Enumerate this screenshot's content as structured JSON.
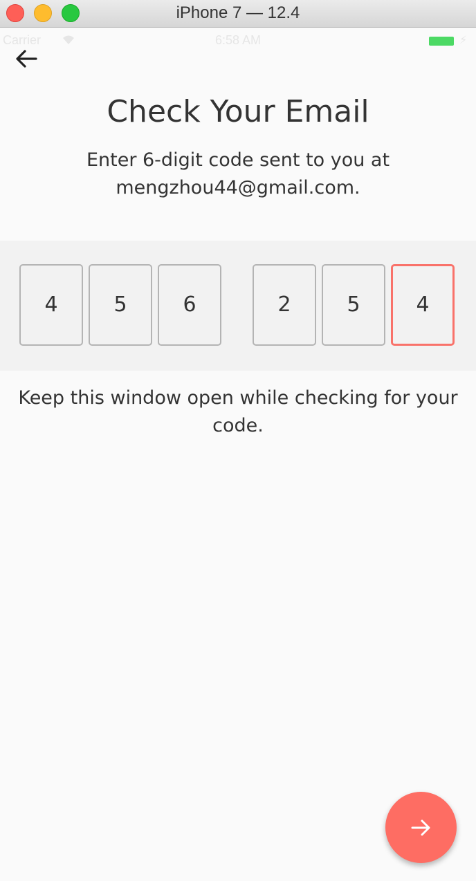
{
  "window": {
    "title": "iPhone 7 — 12.4"
  },
  "status_bar": {
    "carrier": "Carrier",
    "time": "6:58 AM"
  },
  "screen": {
    "title": "Check Your Email",
    "subtitle": "Enter 6-digit code  sent to  you at mengzhou44@gmail.com.",
    "code_digits": [
      "4",
      "5",
      "6",
      "2",
      "5",
      "4"
    ],
    "hint": "Keep this window open while checking for your code."
  },
  "colors": {
    "accent": "#fe6d63",
    "active_border": "#f9726a",
    "text": "#333333",
    "background": "#fafafa",
    "band": "#f2f2f2"
  },
  "icons": {
    "back": "arrow-left-icon",
    "submit": "arrow-right-icon"
  }
}
